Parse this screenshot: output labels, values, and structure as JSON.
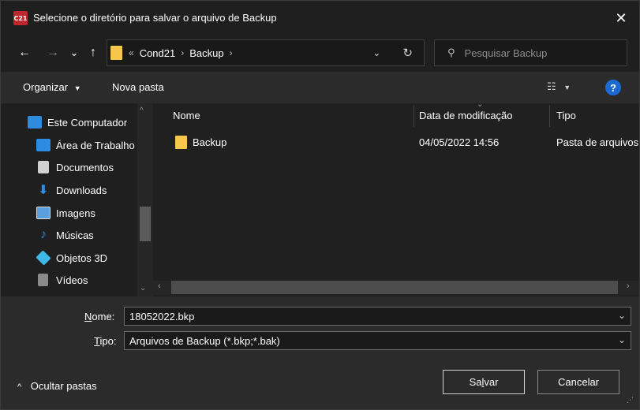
{
  "titlebar": {
    "app_icon": "C21",
    "title": "Selecione o diretório para salvar o arquivo de Backup",
    "close": "✕"
  },
  "nav": {
    "back": "←",
    "forward": "→",
    "recent": "⌄",
    "up": "↑",
    "breadcrumb_overflow": "«",
    "crumbs": [
      "Cond21",
      "Backup"
    ],
    "refresh": "↻",
    "search_placeholder": "Pesquisar Backup"
  },
  "toolbar": {
    "organize": "Organizar",
    "new_folder": "Nova pasta",
    "help": "?"
  },
  "sidebar": {
    "items": [
      {
        "label": "Este Computador",
        "icon": "computer-icon",
        "color": "#2f8be0"
      },
      {
        "label": "Área de Trabalho",
        "icon": "desktop-icon",
        "color": "#2f8be0"
      },
      {
        "label": "Documentos",
        "icon": "documents-icon",
        "color": "#d0d0d0"
      },
      {
        "label": "Downloads",
        "icon": "downloads-icon",
        "color": "#2f8be0"
      },
      {
        "label": "Imagens",
        "icon": "pictures-icon",
        "color": "#5aa0e0"
      },
      {
        "label": "Músicas",
        "icon": "music-icon",
        "color": "#2f8be0"
      },
      {
        "label": "Objetos 3D",
        "icon": "3d-objects-icon",
        "color": "#3fb7e8"
      },
      {
        "label": "Vídeos",
        "icon": "videos-icon",
        "color": "#8a8a8a"
      }
    ]
  },
  "filelist": {
    "columns": [
      "Nome",
      "Data de modificação",
      "Tipo"
    ],
    "rows": [
      {
        "name": "Backup",
        "modified": "04/05/2022 14:56",
        "type": "Pasta de arquivos"
      }
    ]
  },
  "bottom": {
    "name_label_u": "N",
    "name_label_rest": "ome:",
    "filename": "18052022.bkp",
    "type_label_u": "T",
    "type_label_rest": "ipo:",
    "filetype": "Arquivos de Backup (*.bkp;*.bak)",
    "hide_folders": "Ocultar pastas",
    "save_pre": "Sa",
    "save_u": "l",
    "save_post": "var",
    "cancel": "Cancelar"
  },
  "colors": {
    "accent": "#1c6bd4",
    "folder": "#f5c84b",
    "background": "#202020"
  }
}
